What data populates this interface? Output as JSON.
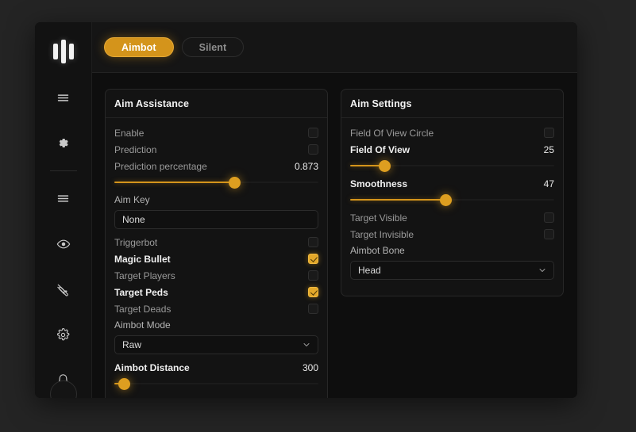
{
  "window": {
    "logo": "equalizer-logo"
  },
  "sidebar": {
    "items": [
      {
        "icon": "menu-icon",
        "name": "sidebar-item-menu-top"
      },
      {
        "icon": "gear-filled-icon",
        "name": "sidebar-item-settings-top"
      },
      {
        "icon": "menu-icon",
        "name": "sidebar-item-menu"
      },
      {
        "icon": "eye-icon",
        "name": "sidebar-item-visuals"
      },
      {
        "icon": "tools-icon",
        "name": "sidebar-item-tools"
      },
      {
        "icon": "gear-icon",
        "name": "sidebar-item-settings"
      },
      {
        "icon": "bell-icon",
        "name": "sidebar-item-notifications"
      }
    ],
    "avatar": "user-avatar"
  },
  "tabs": [
    {
      "label": "Aimbot",
      "active": true
    },
    {
      "label": "Silent",
      "active": false
    }
  ],
  "colors": {
    "accent": "#d4941b",
    "accent_bright": "#e2a72a",
    "panel_bg": "#131313",
    "window_bg": "#0e0e0e",
    "sidebar_bg": "#121212"
  },
  "panels": {
    "aim_assistance": {
      "title": "Aim Assistance",
      "rows": [
        {
          "type": "checkbox",
          "label": "Enable",
          "checked": false
        },
        {
          "type": "checkbox",
          "label": "Prediction",
          "checked": false
        },
        {
          "type": "slider",
          "label": "Prediction percentage",
          "value": "0.873",
          "percent": 59
        },
        {
          "type": "text",
          "label": "Aim Key",
          "value": "None",
          "placeholder": "None"
        },
        {
          "type": "checkbox",
          "label": "Triggerbot",
          "checked": false
        },
        {
          "type": "checkbox",
          "label": "Magic Bullet",
          "checked": true
        },
        {
          "type": "checkbox",
          "label": "Target Players",
          "checked": false
        },
        {
          "type": "checkbox",
          "label": "Target Peds",
          "checked": true
        },
        {
          "type": "checkbox",
          "label": "Target Deads",
          "checked": false
        },
        {
          "type": "select",
          "label": "Aimbot Mode",
          "value": "Raw"
        },
        {
          "type": "slider",
          "label": "Aimbot Distance",
          "value": "300",
          "percent": 5
        }
      ]
    },
    "aim_settings": {
      "title": "Aim Settings",
      "rows": [
        {
          "type": "checkbox",
          "label": "Field Of View Circle",
          "checked": false
        },
        {
          "type": "slider",
          "label": "Field Of View",
          "value": "25",
          "percent": 17
        },
        {
          "type": "slider",
          "label": "Smoothness",
          "value": "47",
          "percent": 47
        },
        {
          "type": "checkbox",
          "label": "Target Visible",
          "checked": false
        },
        {
          "type": "checkbox",
          "label": "Target Invisible",
          "checked": false
        },
        {
          "type": "select",
          "label": "Aimbot Bone",
          "value": "Head"
        }
      ]
    }
  }
}
